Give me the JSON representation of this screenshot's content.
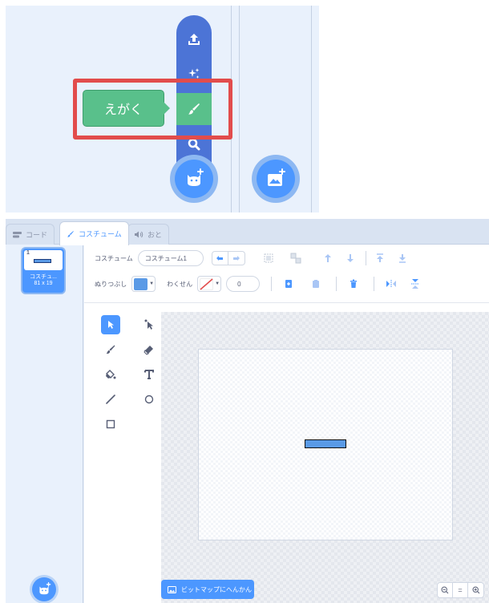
{
  "sprite_menu": {
    "tooltip": "えがく",
    "items": [
      {
        "icon": "upload-icon"
      },
      {
        "icon": "surprise-icon"
      },
      {
        "icon": "paint-brush-icon",
        "active": true
      },
      {
        "icon": "search-icon"
      }
    ],
    "main_button_icon": "cat-plus-icon",
    "stage_button_icon": "image-plus-icon",
    "highlight_color": "#e24c4c",
    "menu_color": "#4c74d6",
    "active_color": "#59c08b"
  },
  "tabs": [
    {
      "label": "コード",
      "icon": "code-icon"
    },
    {
      "label": "コスチューム",
      "icon": "brush-icon",
      "active": true
    },
    {
      "label": "おと",
      "icon": "speaker-icon"
    }
  ],
  "costume_list": {
    "items": [
      {
        "number": "1",
        "name": "コスチュ...",
        "size": "81 x 19",
        "selected": true
      }
    ],
    "add_button_icon": "cat-plus-icon"
  },
  "toolbar": {
    "costume_label": "コスチューム",
    "costume_name": "コスチューム1",
    "fill_label": "ぬりつぶし",
    "fill_color": "#5a9ae6",
    "outline_label": "わくせん",
    "outline_color": "none",
    "outline_width": "0"
  },
  "tools": [
    "select",
    "reshape",
    "brush",
    "eraser",
    "fill",
    "text",
    "line",
    "circle",
    "rectangle"
  ],
  "bottom": {
    "convert_button": "ビットマップにへんかん",
    "zoom_out": "−",
    "zoom_reset": "=",
    "zoom_in": "+"
  }
}
